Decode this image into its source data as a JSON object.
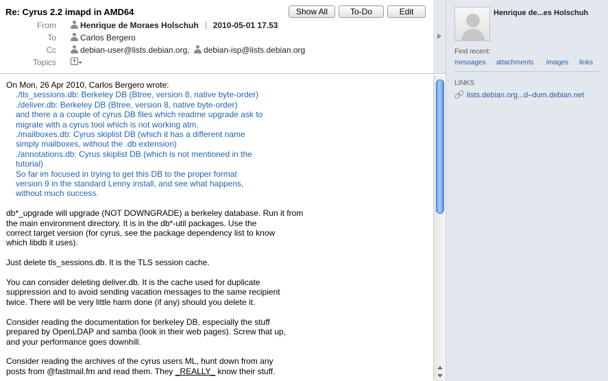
{
  "header": {
    "subject": "Re: Cyrus 2.2 imapd in AMD64",
    "buttons": {
      "show_all": "Show All",
      "todo": "To-Do",
      "edit": "Edit"
    },
    "labels": {
      "from": "From",
      "to": "To",
      "cc": "Cc",
      "topics": "Topics"
    },
    "from_name": "Henrique de Moraes Holschuh",
    "date": "2010-05-01 17.53",
    "to": "Carlos Bergero",
    "cc": [
      "debian-user@lists.debian.org,",
      "debian-isp@lists.debian.org"
    ]
  },
  "body": {
    "attribution": "On Mon, 26 Apr 2010, Carlos Bergero wrote:",
    "quote": [
      "./tls_sessions.db: Berkeley DB (Btree, version 8, native byte-order)",
      "./deliver.db: Berkeley DB (Btree, version 8, native byte-order)",
      "and there a a couple of cyrus DB files which readme upgrade ask to",
      "migrate with a cyrus tool which is not working atm,",
      "./mailboxes.db: Cyrus skiplist DB  (which it has a different name",
      "simply mailboxes, without the .db extension)",
      "./annotations.db: Cyrus skiplist DB  (which is not mentioned in the",
      "tutorial)",
      "So far im focused in trying to get this DB to the proper format",
      "version 9 in the standard Lenny install, and see what happens,",
      "without much success."
    ],
    "para1": [
      "db*_upgrade will upgrade (NOT DOWNGRADE) a berkeley database. Run it from",
      "the main environment directory.  It is in the db*-util packages.  Use the",
      "correct target version (for cyrus, see the package dependency list to know",
      "which libdb it uses)."
    ],
    "para2": [
      "Just delete tls_sessions.db.  It is the TLS session cache."
    ],
    "para3": [
      "You can consider deleting deliver.db.  It is the cache used for duplicate",
      "suppression and to avoid sending vacation messages to the same recipient",
      "twice.  There will be very little harm done (if any) should you delete it."
    ],
    "para4": [
      "Consider reading the documentation for berkeley DB, especially the stuff",
      "prepared by OpenLDAP and samba (look in their web pages).  Screw that up,",
      "and your performance goes downhill."
    ],
    "para5_line1": "Consider reading the archives of the cyrus users ML, hunt down from any",
    "para5_line2_pre": "posts from @fastmail.fm and read them.  They ",
    "para5_line2_em": "_REALLY_",
    "para5_line2_post": " know their stuff."
  },
  "sidebar": {
    "name": "Henrique de...es Holschuh",
    "find_recent": "Find recent:",
    "links": [
      "messages",
      "attachments",
      "images",
      "links"
    ],
    "links_heading": "LINKS",
    "link_item": "lists.debian.org...d–dum.debian.net"
  },
  "icons": {
    "person": "person-icon",
    "add_topic": "add-topic-icon",
    "collapse": "collapse-arrow-icon",
    "link": "link-icon",
    "avatar": "avatar-placeholder"
  },
  "colors": {
    "quote": "#1e63b4",
    "link": "#2c5ca8",
    "sidebar_bg": "#e3e8ee",
    "scroll_thumb": "#6a9fe8"
  }
}
